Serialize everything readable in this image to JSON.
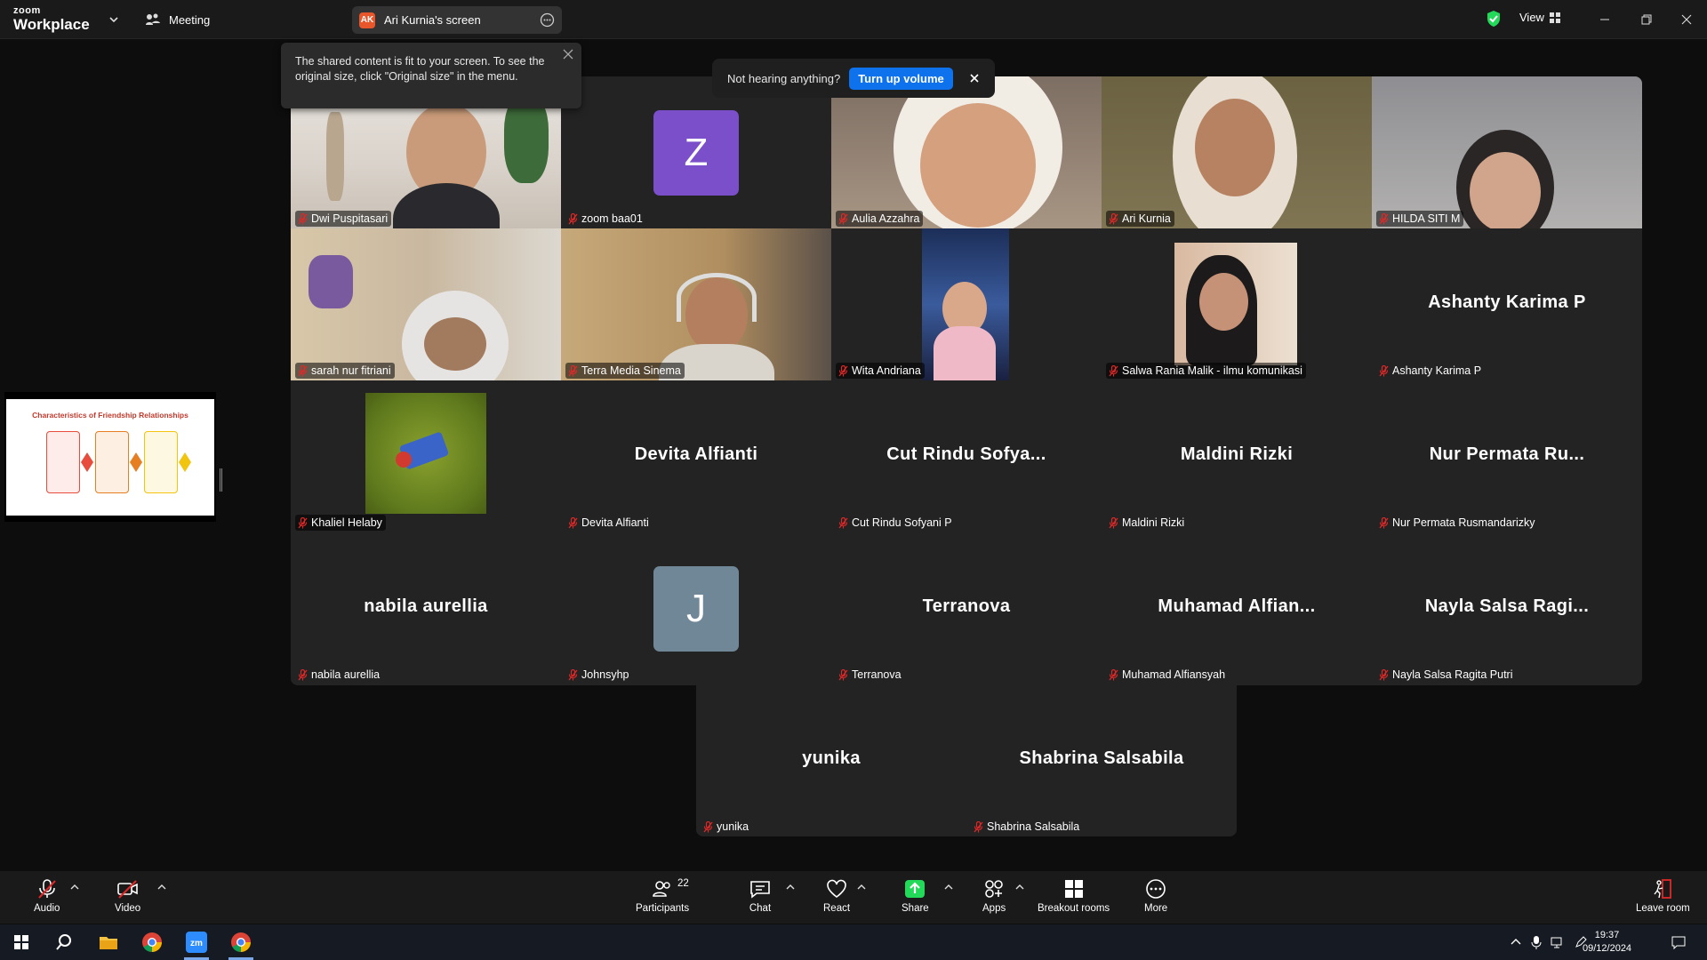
{
  "titlebar": {
    "logo_top": "zoom",
    "logo_bottom": "Workplace",
    "meeting_label": "Meeting",
    "screen_label": "Ari Kurnia's screen",
    "screen_initials": "AK",
    "view_label": "View"
  },
  "tooltip": {
    "text": "The shared content is fit to your screen. To see the original size, click \"Original size\" in the menu."
  },
  "audio_banner": {
    "text": "Not hearing anything?",
    "button": "Turn up volume"
  },
  "shared_thumbnail": {
    "slide_title": "Characteristics of Friendship Relationships"
  },
  "participants": [
    {
      "name": "Dwi Puspitasari",
      "type": "video"
    },
    {
      "name": "zoom baa01",
      "type": "avatar",
      "initial": "Z",
      "color": "#7b4fc9"
    },
    {
      "name": "Aulia Azzahra",
      "type": "video"
    },
    {
      "name": "Ari Kurnia",
      "type": "video",
      "speaking": true
    },
    {
      "name": "HILDA SITI M",
      "type": "video"
    },
    {
      "name": "sarah nur fitriani",
      "type": "video"
    },
    {
      "name": "Terra Media Sinema",
      "type": "video"
    },
    {
      "name": "Wita Andriana",
      "type": "video"
    },
    {
      "name": "Salwa Rania Malik - ilmu komunikasi",
      "type": "video"
    },
    {
      "name": "Ashanty Karima P",
      "display": "Ashanty Karima P",
      "type": "name"
    },
    {
      "name": "Khaliel Helaby",
      "type": "image"
    },
    {
      "name": "Devita Alfianti",
      "display": "Devita Alfianti",
      "type": "name"
    },
    {
      "name": "Cut Rindu Sofyani P",
      "display": "Cut  Rindu  Sofya...",
      "type": "name"
    },
    {
      "name": "Maldini Rizki",
      "display": "Maldini Rizki",
      "type": "name"
    },
    {
      "name": "Nur Permata Rusmandarizky",
      "display": "Nur  Permata  Ru...",
      "type": "name"
    },
    {
      "name": "nabila aurellia",
      "display": "nabila aurellia",
      "type": "name"
    },
    {
      "name": "Johnsyhp",
      "type": "avatar",
      "initial": "J",
      "color": "#6f8796"
    },
    {
      "name": "Terranova",
      "display": "Terranova",
      "type": "name"
    },
    {
      "name": "Muhamad Alfiansyah",
      "display": "Muhamad  Alfian...",
      "type": "name"
    },
    {
      "name": "Nayla Salsa Ragita Putri",
      "display": "Nayla  Salsa  Ragi...",
      "type": "name"
    },
    {
      "name": "yunika",
      "display": "yunika",
      "type": "name"
    },
    {
      "name": "Shabrina Salsabila",
      "display": "Shabrina Salsabila",
      "type": "name"
    }
  ],
  "toolbar": {
    "audio": "Audio",
    "video": "Video",
    "participants": "Participants",
    "participants_count": "22",
    "chat": "Chat",
    "react": "React",
    "share": "Share",
    "apps": "Apps",
    "breakout": "Breakout rooms",
    "more": "More",
    "leave": "Leave room"
  },
  "taskbar": {
    "time": "19:37",
    "date": "09/12/2024"
  },
  "colors": {
    "accent": "#0e72ed",
    "speaker_border": "#23d959",
    "share_green": "#23d959",
    "muted_red": "#e02828"
  }
}
